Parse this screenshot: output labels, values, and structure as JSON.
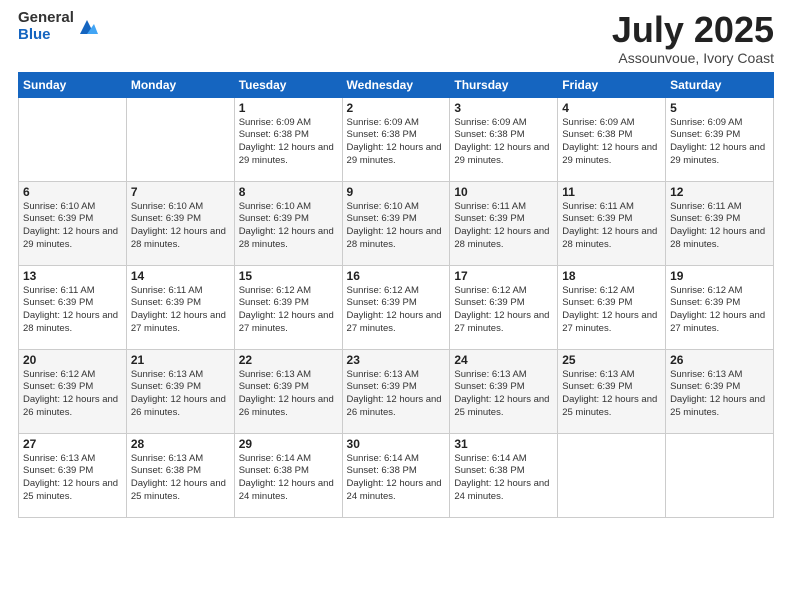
{
  "logo": {
    "general": "General",
    "blue": "Blue"
  },
  "title": "July 2025",
  "subtitle": "Assounvoue, Ivory Coast",
  "weekdays": [
    "Sunday",
    "Monday",
    "Tuesday",
    "Wednesday",
    "Thursday",
    "Friday",
    "Saturday"
  ],
  "weeks": [
    [
      {
        "day": "",
        "info": ""
      },
      {
        "day": "",
        "info": ""
      },
      {
        "day": "1",
        "info": "Sunrise: 6:09 AM\nSunset: 6:38 PM\nDaylight: 12 hours and 29 minutes."
      },
      {
        "day": "2",
        "info": "Sunrise: 6:09 AM\nSunset: 6:38 PM\nDaylight: 12 hours and 29 minutes."
      },
      {
        "day": "3",
        "info": "Sunrise: 6:09 AM\nSunset: 6:38 PM\nDaylight: 12 hours and 29 minutes."
      },
      {
        "day": "4",
        "info": "Sunrise: 6:09 AM\nSunset: 6:38 PM\nDaylight: 12 hours and 29 minutes."
      },
      {
        "day": "5",
        "info": "Sunrise: 6:09 AM\nSunset: 6:39 PM\nDaylight: 12 hours and 29 minutes."
      }
    ],
    [
      {
        "day": "6",
        "info": "Sunrise: 6:10 AM\nSunset: 6:39 PM\nDaylight: 12 hours and 29 minutes."
      },
      {
        "day": "7",
        "info": "Sunrise: 6:10 AM\nSunset: 6:39 PM\nDaylight: 12 hours and 28 minutes."
      },
      {
        "day": "8",
        "info": "Sunrise: 6:10 AM\nSunset: 6:39 PM\nDaylight: 12 hours and 28 minutes."
      },
      {
        "day": "9",
        "info": "Sunrise: 6:10 AM\nSunset: 6:39 PM\nDaylight: 12 hours and 28 minutes."
      },
      {
        "day": "10",
        "info": "Sunrise: 6:11 AM\nSunset: 6:39 PM\nDaylight: 12 hours and 28 minutes."
      },
      {
        "day": "11",
        "info": "Sunrise: 6:11 AM\nSunset: 6:39 PM\nDaylight: 12 hours and 28 minutes."
      },
      {
        "day": "12",
        "info": "Sunrise: 6:11 AM\nSunset: 6:39 PM\nDaylight: 12 hours and 28 minutes."
      }
    ],
    [
      {
        "day": "13",
        "info": "Sunrise: 6:11 AM\nSunset: 6:39 PM\nDaylight: 12 hours and 28 minutes."
      },
      {
        "day": "14",
        "info": "Sunrise: 6:11 AM\nSunset: 6:39 PM\nDaylight: 12 hours and 27 minutes."
      },
      {
        "day": "15",
        "info": "Sunrise: 6:12 AM\nSunset: 6:39 PM\nDaylight: 12 hours and 27 minutes."
      },
      {
        "day": "16",
        "info": "Sunrise: 6:12 AM\nSunset: 6:39 PM\nDaylight: 12 hours and 27 minutes."
      },
      {
        "day": "17",
        "info": "Sunrise: 6:12 AM\nSunset: 6:39 PM\nDaylight: 12 hours and 27 minutes."
      },
      {
        "day": "18",
        "info": "Sunrise: 6:12 AM\nSunset: 6:39 PM\nDaylight: 12 hours and 27 minutes."
      },
      {
        "day": "19",
        "info": "Sunrise: 6:12 AM\nSunset: 6:39 PM\nDaylight: 12 hours and 27 minutes."
      }
    ],
    [
      {
        "day": "20",
        "info": "Sunrise: 6:12 AM\nSunset: 6:39 PM\nDaylight: 12 hours and 26 minutes."
      },
      {
        "day": "21",
        "info": "Sunrise: 6:13 AM\nSunset: 6:39 PM\nDaylight: 12 hours and 26 minutes."
      },
      {
        "day": "22",
        "info": "Sunrise: 6:13 AM\nSunset: 6:39 PM\nDaylight: 12 hours and 26 minutes."
      },
      {
        "day": "23",
        "info": "Sunrise: 6:13 AM\nSunset: 6:39 PM\nDaylight: 12 hours and 26 minutes."
      },
      {
        "day": "24",
        "info": "Sunrise: 6:13 AM\nSunset: 6:39 PM\nDaylight: 12 hours and 25 minutes."
      },
      {
        "day": "25",
        "info": "Sunrise: 6:13 AM\nSunset: 6:39 PM\nDaylight: 12 hours and 25 minutes."
      },
      {
        "day": "26",
        "info": "Sunrise: 6:13 AM\nSunset: 6:39 PM\nDaylight: 12 hours and 25 minutes."
      }
    ],
    [
      {
        "day": "27",
        "info": "Sunrise: 6:13 AM\nSunset: 6:39 PM\nDaylight: 12 hours and 25 minutes."
      },
      {
        "day": "28",
        "info": "Sunrise: 6:13 AM\nSunset: 6:38 PM\nDaylight: 12 hours and 25 minutes."
      },
      {
        "day": "29",
        "info": "Sunrise: 6:14 AM\nSunset: 6:38 PM\nDaylight: 12 hours and 24 minutes."
      },
      {
        "day": "30",
        "info": "Sunrise: 6:14 AM\nSunset: 6:38 PM\nDaylight: 12 hours and 24 minutes."
      },
      {
        "day": "31",
        "info": "Sunrise: 6:14 AM\nSunset: 6:38 PM\nDaylight: 12 hours and 24 minutes."
      },
      {
        "day": "",
        "info": ""
      },
      {
        "day": "",
        "info": ""
      }
    ]
  ]
}
